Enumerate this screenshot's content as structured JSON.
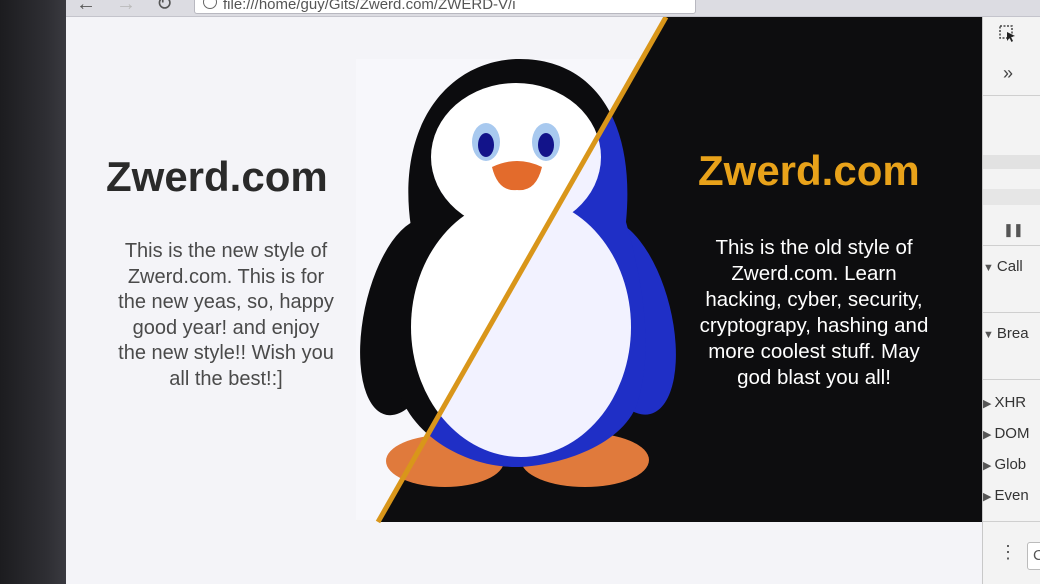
{
  "browser": {
    "url": "file:///home/guy/Gits/Zwerd.com/ZWERD-V/i",
    "back_glyph": "←",
    "forward_glyph": "→",
    "reload_glyph": "↻"
  },
  "page": {
    "new_style": {
      "title": "Zwerd.com",
      "text": "This is the new style of Zwerd.com. This is for the new yeas, so, happy good year! and enjoy the new style!! Wish you all the best!:]"
    },
    "old_style": {
      "title": "Zwerd.com",
      "text": "This is the old style of Zwerd.com. Learn hacking, cyber, security, cryptograpy, hashing and more coolest stuff. May god blast you all!"
    }
  },
  "devtools": {
    "overflow_glyph": "»",
    "pause_glyph": "❚❚",
    "sections": [
      "Call",
      "Brea",
      "XHR",
      "DOM",
      "Glob",
      "Even"
    ],
    "console_prompt": "C",
    "more_glyph": "⋮"
  },
  "colors": {
    "old_bg": "#0d0d0f",
    "new_bg": "#f4f4f8",
    "accent": "#e8a21a",
    "divider": "#d9961a",
    "penguin_blue": "#1f2fc6",
    "beak": "#e36b2c"
  },
  "icons": [
    "back-arrow-icon",
    "forward-arrow-icon",
    "reload-icon",
    "info-icon",
    "inspect-icon",
    "chevrons-icon",
    "pause-icon",
    "triangle-down-icon",
    "triangle-right-icon",
    "more-icon",
    "penguin-logo"
  ]
}
